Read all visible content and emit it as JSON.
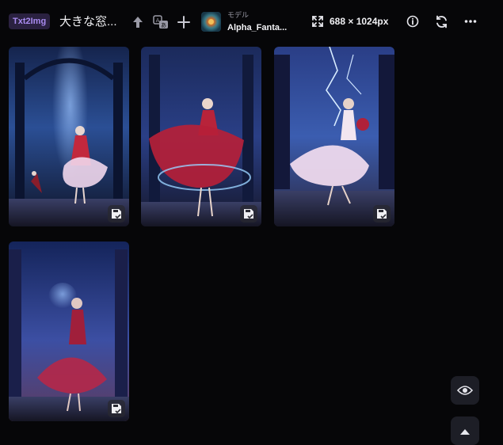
{
  "header": {
    "mode_badge": "Txt2Img",
    "prompt_title": "大きな窓...",
    "model_caption": "モデル",
    "model_name": "Alpha_Fanta...",
    "dimensions": "688 × 1024px"
  },
  "icons": {
    "upload": "arrow-up-icon",
    "translate": "translate-icon",
    "add": "plus-icon",
    "expand": "expand-icon",
    "info": "info-icon",
    "refresh": "refresh-icon",
    "more": "more-horizontal-icon",
    "save": "save-check-icon",
    "view": "eye-icon",
    "scroll_top": "chevron-up-icon"
  },
  "colors": {
    "background": "#060608",
    "badge_bg": "#2a2140",
    "badge_text": "#a98bf0",
    "fab_bg": "#1d1e26"
  },
  "gallery": [
    {
      "name": "generated-image-1"
    },
    {
      "name": "generated-image-2"
    },
    {
      "name": "generated-image-3"
    },
    {
      "name": "generated-image-4"
    }
  ]
}
